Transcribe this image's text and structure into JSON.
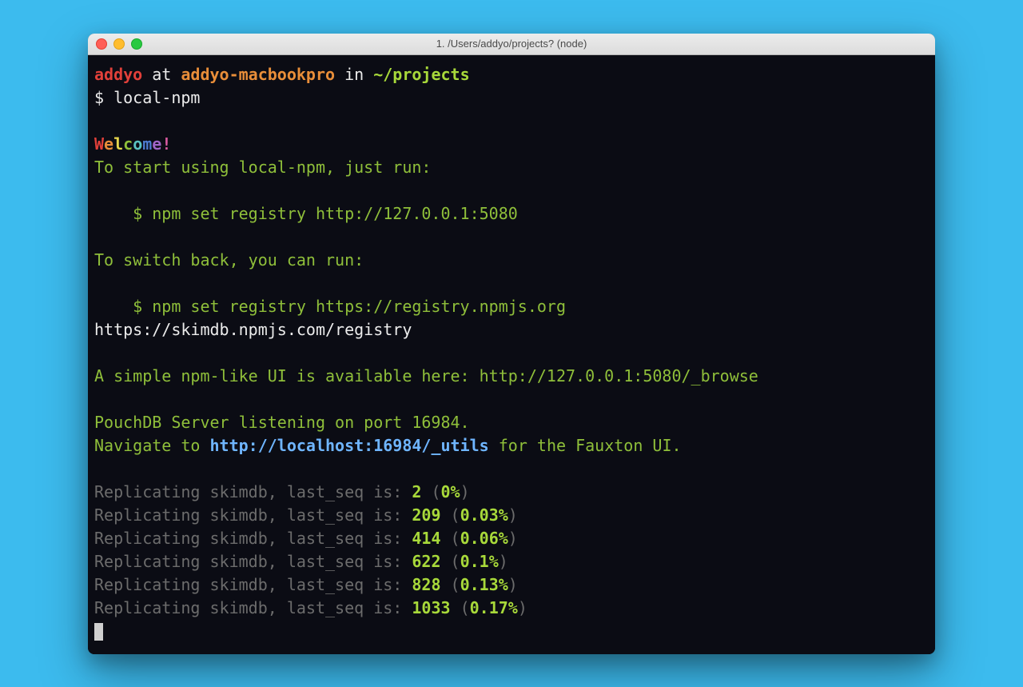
{
  "window_title": "1. /Users/addyo/projects? (node)",
  "prompt": {
    "user": "addyo",
    "at": " at ",
    "host": "addyo-macbookpro",
    "in": " in ",
    "path": "~/projects",
    "symbol": "$ ",
    "command": "local-npm"
  },
  "welcome_chars": [
    "W",
    "e",
    "l",
    "c",
    "o",
    "m",
    "e",
    "!"
  ],
  "welcome_colors": [
    "c-red",
    "c-orange",
    "c-yellow",
    "c-green",
    "c-cyan",
    "c-blue",
    "c-purple",
    "c-pink"
  ],
  "lines": {
    "to_start": "To start using local-npm, just run:",
    "cmd1": "    $ npm set registry http://127.0.0.1:5080",
    "to_switch": "To switch back, you can run:",
    "cmd2": "    $ npm set registry https://registry.npmjs.org",
    "skimdb_url": "https://skimdb.npmjs.com/registry",
    "browse": "A simple npm-like UI is available here: http://127.0.0.1:5080/_browse",
    "pouch": "PouchDB Server listening on port 16984.",
    "fauxton_a": "Navigate to ",
    "fauxton_b": "http://localhost:16984/_utils",
    "fauxton_c": " for the Fauxton UI."
  },
  "repl_prefix": "Replicating skimdb, last_seq is: ",
  "repl": [
    {
      "seq": "2",
      "pct": "0%"
    },
    {
      "seq": "209",
      "pct": "0.03%"
    },
    {
      "seq": "414",
      "pct": "0.06%"
    },
    {
      "seq": "622",
      "pct": "0.1%"
    },
    {
      "seq": "828",
      "pct": "0.13%"
    },
    {
      "seq": "1033",
      "pct": "0.17%"
    }
  ]
}
